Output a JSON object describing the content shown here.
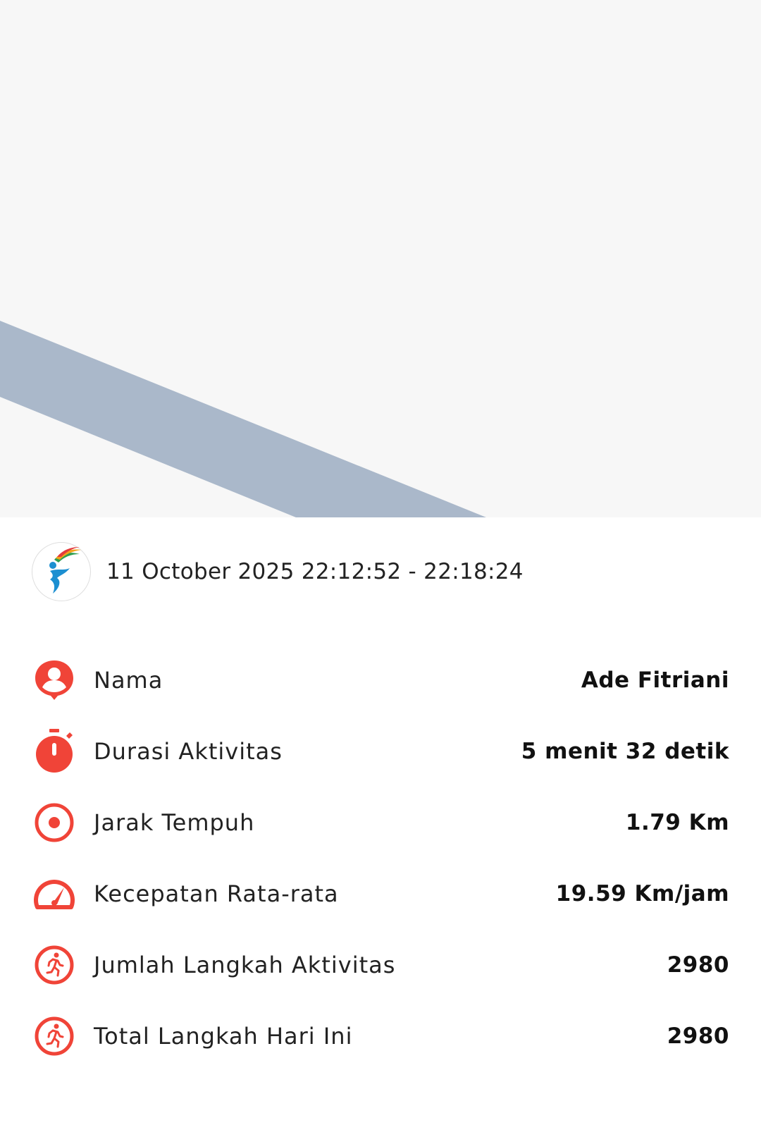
{
  "activity": {
    "datetime": "11 October 2025 22:12:52 - 22:18:24"
  },
  "stats": [
    {
      "label": "Nama",
      "value": "Ade Fitriani",
      "icon": "person-pin-icon"
    },
    {
      "label": "Durasi Aktivitas",
      "value": "5 menit 32 detik",
      "icon": "stopwatch-icon"
    },
    {
      "label": "Jarak Tempuh",
      "value": "1.79 Km",
      "icon": "target-icon"
    },
    {
      "label": "Kecepatan Rata-rata",
      "value": "19.59 Km/jam",
      "icon": "speedometer-icon"
    },
    {
      "label": "Jumlah Langkah Aktivitas",
      "value": "2980",
      "icon": "running-icon"
    },
    {
      "label": "Total Langkah Hari Ini",
      "value": "2980",
      "icon": "running-icon"
    }
  ],
  "colors": {
    "accent": "#f04438",
    "map_background": "#f7f7f7",
    "road": "#aab8ca"
  }
}
